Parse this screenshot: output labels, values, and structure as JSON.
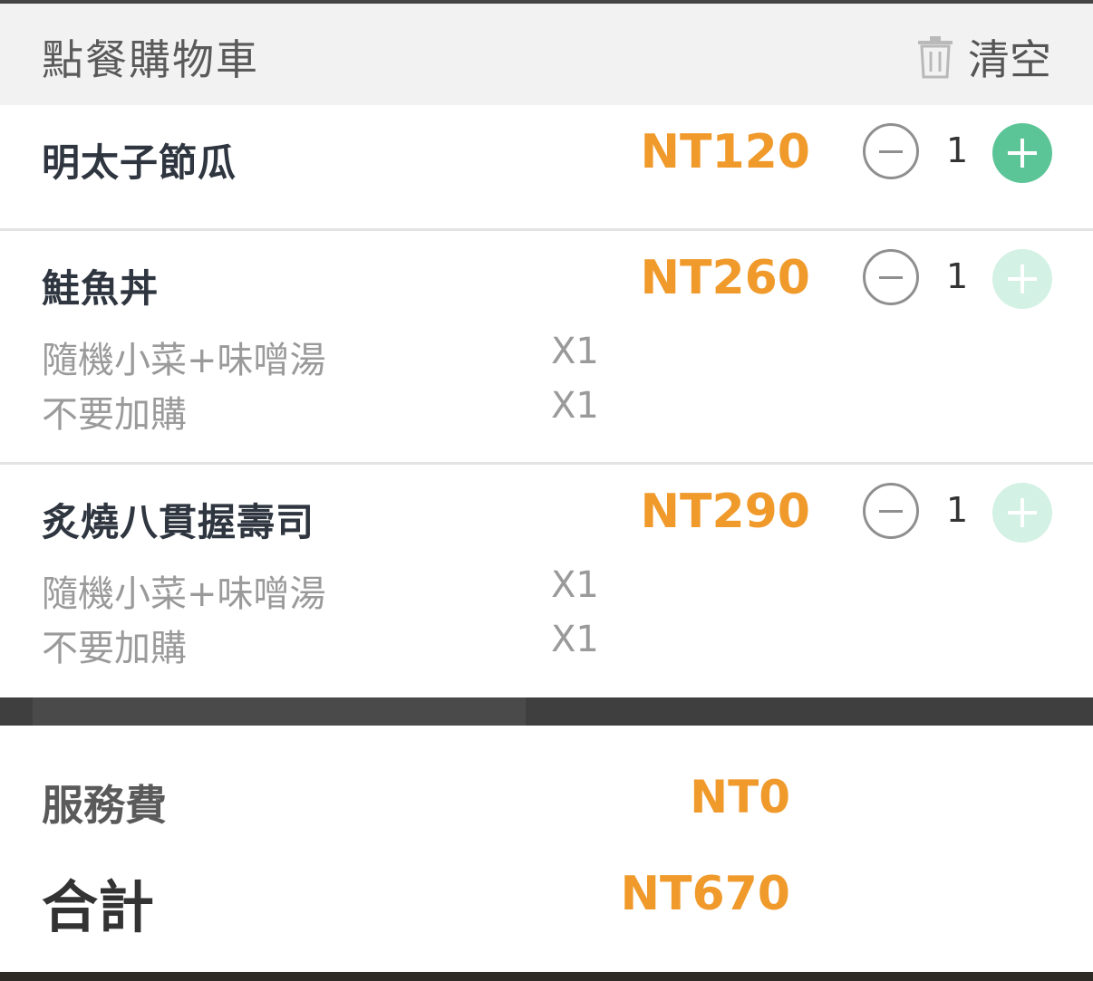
{
  "header": {
    "title": "點餐購物車",
    "clear_label": "清空"
  },
  "items": [
    {
      "name": "明太子節瓜",
      "price": "NT120",
      "qty": "1",
      "plus_enabled": true,
      "options": []
    },
    {
      "name": "鮭魚丼",
      "price": "NT260",
      "qty": "1",
      "plus_enabled": false,
      "options": [
        {
          "name": "隨機小菜+味噌湯",
          "qty": "X1"
        },
        {
          "name": "不要加購",
          "qty": "X1"
        }
      ]
    },
    {
      "name": "炙燒八貫握壽司",
      "price": "NT290",
      "qty": "1",
      "plus_enabled": false,
      "options": [
        {
          "name": "隨機小菜+味噌湯",
          "qty": "X1"
        },
        {
          "name": "不要加購",
          "qty": "X1"
        }
      ]
    }
  ],
  "summary": {
    "service_label": "服務費",
    "service_value": "NT0",
    "total_label": "合計",
    "total_value": "NT670"
  },
  "colors": {
    "price": "#f09a2c",
    "plus_active": "#5cc597",
    "plus_disabled": "#d3f1e4"
  }
}
